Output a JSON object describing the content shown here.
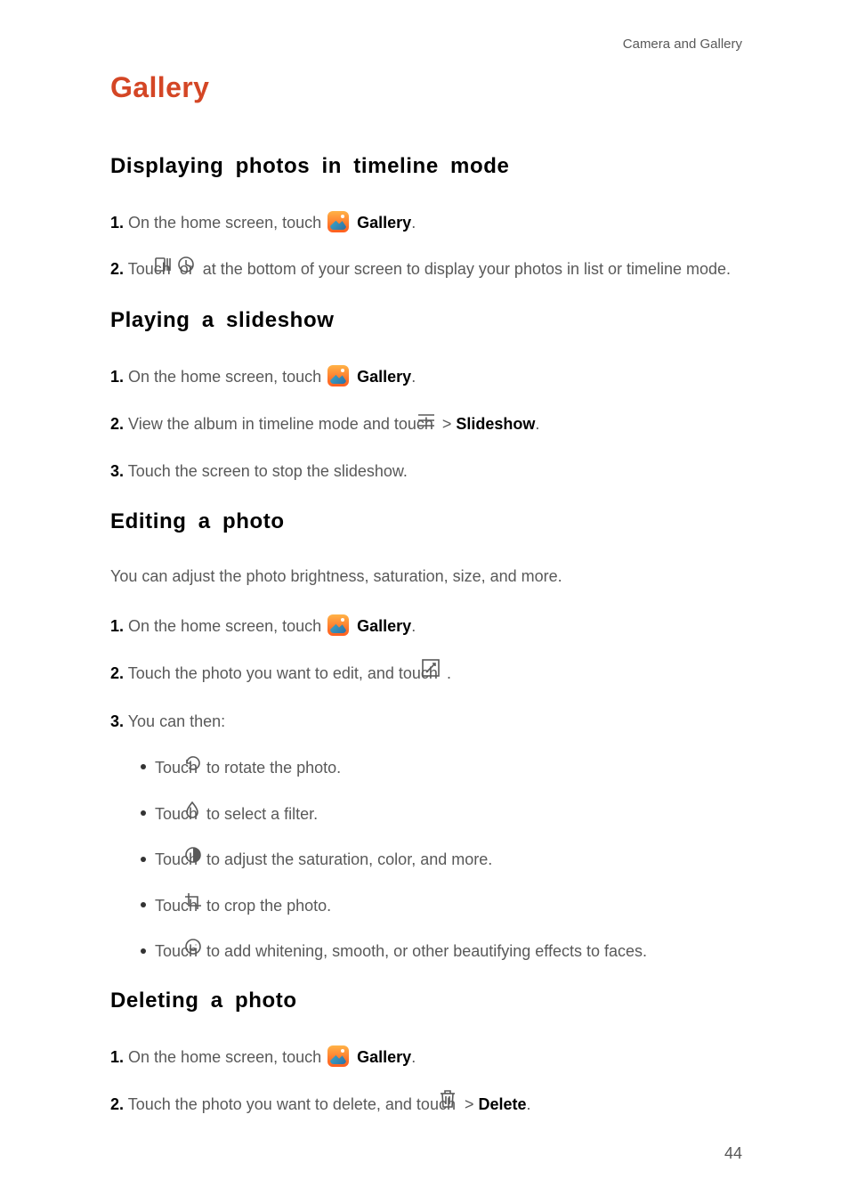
{
  "breadcrumb": "Camera and Gallery",
  "title": "Gallery",
  "page_number": "44",
  "sections": {
    "timeline": {
      "heading": "Displaying  photos  in  timeline  mode",
      "step1_num": "1.",
      "step1_pre": " On the home screen, touch ",
      "step1_label": " Gallery",
      "step1_dot": ".",
      "step2_num": "2.",
      "step2_pre": " Touch ",
      "step2_mid": " or ",
      "step2_text": " at the bottom of your screen to display your photos in list or timeline mode."
    },
    "slideshow": {
      "heading": "Playing  a  slideshow",
      "step1_num": "1.",
      "step1_pre": " On the home screen, touch ",
      "step1_label": " Gallery",
      "step1_dot": ".",
      "step2_num": "2.",
      "step2_pre": " View the album in timeline mode and touch ",
      "step2_gt": "  > ",
      "step2_bold": "Slideshow",
      "step2_dot": ".",
      "step3_num": "3.",
      "step3_text": " Touch the screen to stop the slideshow."
    },
    "editing": {
      "heading": "Editing  a  photo",
      "intro": "You can adjust the photo brightness, saturation, size, and more.",
      "step1_num": "1.",
      "step1_pre": " On the home screen, touch ",
      "step1_label": " Gallery",
      "step1_dot": ".",
      "step2_num": "2.",
      "step2_pre": " Touch the photo you want to edit, and touch ",
      "step2_dot": " .",
      "step3_num": "3.",
      "step3_text": " You can then:",
      "b1_pre": "Touch ",
      "b1_text": " to rotate the photo.",
      "b2_pre": "Touch ",
      "b2_text": " to select a filter.",
      "b3_pre": "Touch ",
      "b3_text": " to adjust the saturation, color, and more.",
      "b4_pre": "Touch ",
      "b4_text": " to crop the photo.",
      "b5_pre": "Touch ",
      "b5_text": " to add whitening, smooth, or other beautifying effects to faces."
    },
    "deleting": {
      "heading": "Deleting  a  photo",
      "step1_num": "1.",
      "step1_pre": " On the home screen, touch ",
      "step1_label": " Gallery",
      "step1_dot": ".",
      "step2_num": "2.",
      "step2_pre": " Touch the photo you want to delete, and touch ",
      "step2_gt": "  > ",
      "step2_bold": "Delete",
      "step2_dot": "."
    }
  }
}
